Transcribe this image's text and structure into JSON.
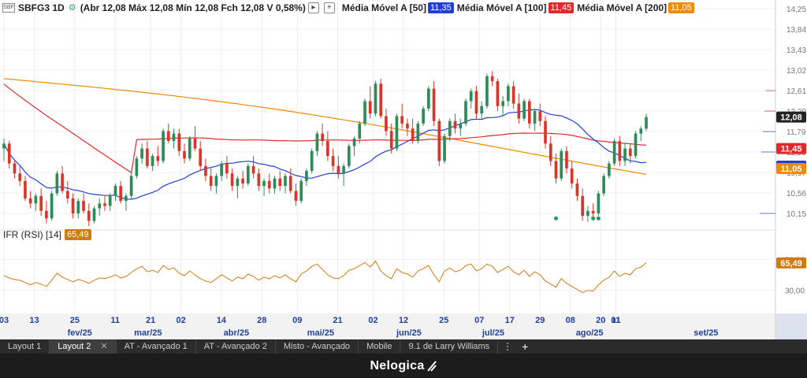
{
  "header": {
    "symbol": "SBFG3 1D",
    "ohlc_text": "(Abr 12,08 Máx 12,08 Mín 12,08 Fch 12,08 V 0,58%)",
    "ma50_label": "Média Móvel A [50]",
    "ma50_value": "11,35",
    "ma100_label": "Média Móvel A [100]",
    "ma100_value": "11,45",
    "ma200_label": "Média Móvel A [200]",
    "ma200_value": "11,05",
    "icons": [
      "chart-symbol-icon",
      "settings-icon",
      "collapse-icon",
      "add-icon"
    ]
  },
  "rsi": {
    "label": "IFR (RSI) [14]",
    "value": "65,49"
  },
  "colors": {
    "up": "#2e8b57",
    "down": "#d9362b",
    "ma50": "#1f3fd6",
    "ma100": "#e0292b",
    "ma200": "#f08a00",
    "rsi": "#d07a10",
    "price_badge": "#222222"
  },
  "chart_data": {
    "type": "line",
    "price_axis": {
      "ticks": [
        "14,25",
        "13,84",
        "13,43",
        "13,02",
        "12,61",
        "12,20",
        "11,79",
        "11,38",
        "10,97",
        "10,56",
        "10,15"
      ],
      "ylim": [
        9.85,
        14.3
      ],
      "current_price": "12,08"
    },
    "rsi_axis": {
      "ticks": [
        "70,00",
        "30,00"
      ],
      "ylim": [
        0,
        100
      ]
    },
    "x_labels": [
      "03",
      "13",
      "25",
      "11",
      "21",
      "02",
      "14",
      "28",
      "09",
      "21",
      "02",
      "12",
      "25",
      "07",
      "17",
      "29",
      "08",
      "20",
      "01",
      "11"
    ],
    "month_labels": [
      "fev/25",
      "mar/25",
      "abr/25",
      "mai/25",
      "jun/25",
      "jul/25",
      "ago/25",
      "set/25"
    ],
    "candles": [
      [
        11.45,
        11.65,
        11.2,
        11.55
      ],
      [
        11.55,
        11.6,
        11.05,
        11.15
      ],
      [
        11.15,
        11.2,
        10.85,
        10.95
      ],
      [
        10.95,
        11.1,
        10.7,
        10.8
      ],
      [
        10.8,
        10.9,
        10.4,
        10.45
      ],
      [
        10.45,
        10.6,
        10.25,
        10.35
      ],
      [
        10.35,
        10.55,
        10.2,
        10.5
      ],
      [
        10.5,
        10.65,
        10.1,
        10.2
      ],
      [
        10.2,
        10.4,
        9.95,
        10.05
      ],
      [
        10.05,
        10.6,
        10.0,
        10.55
      ],
      [
        10.55,
        11.0,
        10.5,
        10.95
      ],
      [
        10.95,
        11.1,
        10.55,
        10.6
      ],
      [
        10.6,
        10.8,
        10.35,
        10.45
      ],
      [
        10.45,
        10.55,
        10.05,
        10.15
      ],
      [
        10.15,
        10.45,
        10.05,
        10.4
      ],
      [
        10.4,
        10.55,
        10.15,
        10.2
      ],
      [
        10.2,
        10.35,
        9.9,
        10.0
      ],
      [
        10.0,
        10.3,
        9.95,
        10.25
      ],
      [
        10.25,
        10.45,
        10.1,
        10.35
      ],
      [
        10.35,
        10.5,
        10.2,
        10.3
      ],
      [
        10.3,
        10.55,
        10.2,
        10.5
      ],
      [
        10.5,
        10.75,
        10.4,
        10.7
      ],
      [
        10.7,
        10.8,
        10.35,
        10.4
      ],
      [
        10.4,
        10.55,
        10.2,
        10.5
      ],
      [
        10.5,
        10.95,
        10.45,
        10.9
      ],
      [
        10.9,
        11.3,
        10.85,
        11.25
      ],
      [
        11.25,
        11.55,
        11.15,
        11.45
      ],
      [
        11.45,
        11.6,
        11.05,
        11.1
      ],
      [
        11.1,
        11.35,
        11.0,
        11.3
      ],
      [
        11.3,
        11.5,
        11.1,
        11.2
      ],
      [
        11.2,
        11.85,
        11.15,
        11.8
      ],
      [
        11.8,
        11.95,
        11.55,
        11.6
      ],
      [
        11.6,
        11.85,
        11.45,
        11.75
      ],
      [
        11.75,
        11.85,
        11.3,
        11.4
      ],
      [
        11.4,
        11.55,
        11.15,
        11.25
      ],
      [
        11.25,
        11.7,
        11.2,
        11.65
      ],
      [
        11.65,
        11.9,
        11.4,
        11.45
      ],
      [
        11.45,
        11.6,
        11.0,
        11.1
      ],
      [
        11.1,
        11.25,
        10.8,
        10.9
      ],
      [
        10.9,
        11.05,
        10.6,
        10.7
      ],
      [
        10.7,
        10.95,
        10.55,
        10.9
      ],
      [
        10.9,
        11.2,
        10.8,
        11.15
      ],
      [
        11.15,
        11.3,
        10.85,
        10.95
      ],
      [
        10.95,
        11.05,
        10.6,
        10.7
      ],
      [
        10.7,
        10.9,
        10.45,
        10.85
      ],
      [
        10.85,
        11.0,
        10.65,
        10.75
      ],
      [
        10.75,
        11.15,
        10.7,
        11.1
      ],
      [
        11.1,
        11.3,
        10.85,
        10.95
      ],
      [
        10.95,
        11.05,
        10.6,
        10.7
      ],
      [
        10.7,
        10.85,
        10.5,
        10.8
      ],
      [
        10.8,
        10.95,
        10.55,
        10.65
      ],
      [
        10.65,
        10.9,
        10.55,
        10.85
      ],
      [
        10.85,
        11.0,
        10.6,
        10.7
      ],
      [
        10.7,
        10.95,
        10.55,
        10.9
      ],
      [
        10.9,
        11.05,
        10.55,
        10.6
      ],
      [
        10.6,
        10.75,
        10.3,
        10.4
      ],
      [
        10.4,
        10.85,
        10.35,
        10.8
      ],
      [
        10.8,
        11.05,
        10.7,
        11.0
      ],
      [
        11.0,
        11.45,
        10.95,
        11.4
      ],
      [
        11.4,
        11.8,
        11.3,
        11.75
      ],
      [
        11.75,
        11.95,
        11.5,
        11.6
      ],
      [
        11.6,
        11.8,
        11.2,
        11.3
      ],
      [
        11.3,
        11.45,
        11.0,
        11.1
      ],
      [
        11.1,
        11.3,
        10.85,
        10.95
      ],
      [
        10.95,
        11.15,
        10.7,
        11.1
      ],
      [
        11.1,
        11.55,
        11.05,
        11.5
      ],
      [
        11.5,
        11.7,
        11.3,
        11.65
      ],
      [
        11.65,
        12.0,
        11.55,
        11.95
      ],
      [
        11.95,
        12.45,
        11.9,
        12.4
      ],
      [
        12.4,
        12.7,
        12.05,
        12.15
      ],
      [
        12.15,
        12.8,
        12.1,
        12.75
      ],
      [
        12.75,
        12.85,
        12.05,
        12.1
      ],
      [
        12.1,
        12.25,
        11.7,
        11.8
      ],
      [
        11.8,
        11.95,
        11.35,
        11.45
      ],
      [
        11.45,
        12.15,
        11.4,
        12.1
      ],
      [
        12.1,
        12.35,
        11.85,
        11.95
      ],
      [
        11.95,
        12.05,
        11.7,
        11.85
      ],
      [
        11.85,
        12.05,
        11.55,
        11.6
      ],
      [
        11.6,
        12.0,
        11.55,
        11.95
      ],
      [
        11.95,
        12.3,
        11.9,
        12.25
      ],
      [
        12.25,
        12.7,
        12.2,
        12.65
      ],
      [
        12.65,
        12.8,
        11.9,
        12.0
      ],
      [
        12.0,
        12.05,
        11.1,
        11.2
      ],
      [
        11.2,
        11.75,
        11.15,
        11.7
      ],
      [
        11.7,
        12.05,
        11.6,
        12.0
      ],
      [
        12.0,
        12.15,
        11.75,
        11.85
      ],
      [
        11.85,
        12.05,
        11.7,
        11.95
      ],
      [
        11.95,
        12.45,
        11.9,
        12.4
      ],
      [
        12.4,
        12.65,
        12.25,
        12.6
      ],
      [
        12.6,
        12.7,
        12.05,
        12.15
      ],
      [
        12.15,
        12.4,
        12.05,
        12.3
      ],
      [
        12.3,
        12.95,
        12.25,
        12.9
      ],
      [
        12.9,
        13.0,
        12.7,
        12.8
      ],
      [
        12.8,
        12.85,
        12.2,
        12.3
      ],
      [
        12.3,
        12.5,
        12.1,
        12.4
      ],
      [
        12.4,
        12.75,
        12.3,
        12.7
      ],
      [
        12.7,
        12.8,
        12.25,
        12.35
      ],
      [
        12.35,
        12.55,
        11.95,
        12.05
      ],
      [
        12.05,
        12.45,
        12.0,
        12.4
      ],
      [
        12.4,
        12.45,
        11.85,
        11.95
      ],
      [
        11.95,
        12.25,
        11.8,
        12.2
      ],
      [
        12.2,
        12.35,
        11.9,
        12.0
      ],
      [
        12.0,
        12.1,
        11.45,
        11.55
      ],
      [
        11.55,
        11.7,
        11.1,
        11.2
      ],
      [
        11.2,
        11.35,
        10.75,
        10.85
      ],
      [
        10.85,
        11.45,
        10.8,
        11.4
      ],
      [
        11.4,
        11.5,
        10.95,
        11.05
      ],
      [
        11.05,
        11.2,
        10.65,
        10.75
      ],
      [
        10.75,
        10.85,
        10.4,
        10.5
      ],
      [
        10.5,
        10.65,
        10.0,
        10.1
      ],
      [
        10.1,
        10.3,
        9.98,
        10.2
      ],
      [
        10.2,
        10.35,
        10.05,
        10.15
      ],
      [
        10.15,
        10.6,
        10.1,
        10.55
      ],
      [
        10.55,
        10.95,
        10.5,
        10.9
      ],
      [
        10.9,
        11.2,
        10.85,
        11.15
      ],
      [
        11.15,
        11.65,
        11.1,
        11.6
      ],
      [
        11.6,
        11.7,
        11.1,
        11.2
      ],
      [
        11.2,
        11.55,
        11.1,
        11.45
      ],
      [
        11.45,
        11.55,
        11.15,
        11.3
      ],
      [
        11.3,
        11.8,
        11.25,
        11.75
      ],
      [
        11.75,
        11.9,
        11.6,
        11.85
      ],
      [
        11.85,
        12.15,
        11.8,
        12.08
      ]
    ],
    "rsi_values": [
      49,
      46,
      44,
      43,
      40,
      37,
      40,
      38,
      35,
      43,
      52,
      47,
      44,
      41,
      44,
      42,
      39,
      43,
      46,
      45,
      47,
      50,
      46,
      48,
      53,
      58,
      61,
      54,
      56,
      53,
      62,
      57,
      59,
      52,
      49,
      55,
      50,
      45,
      42,
      40,
      45,
      50,
      46,
      42,
      47,
      45,
      51,
      48,
      43,
      47,
      45,
      49,
      46,
      50,
      45,
      41,
      51,
      55,
      61,
      64,
      57,
      50,
      46,
      45,
      49,
      56,
      58,
      62,
      66,
      60,
      68,
      55,
      49,
      45,
      58,
      53,
      51,
      47,
      55,
      58,
      62,
      50,
      41,
      55,
      59,
      54,
      56,
      62,
      64,
      55,
      58,
      64,
      61,
      53,
      57,
      61,
      54,
      50,
      56,
      48,
      54,
      50,
      42,
      38,
      34,
      45,
      39,
      35,
      31,
      27,
      30,
      29,
      37,
      43,
      47,
      55,
      48,
      52,
      50,
      58,
      60,
      65.49
    ],
    "volume_markers": [
      "12,61",
      "12,20",
      "11,79",
      "11,38",
      "10,15"
    ]
  }
}
